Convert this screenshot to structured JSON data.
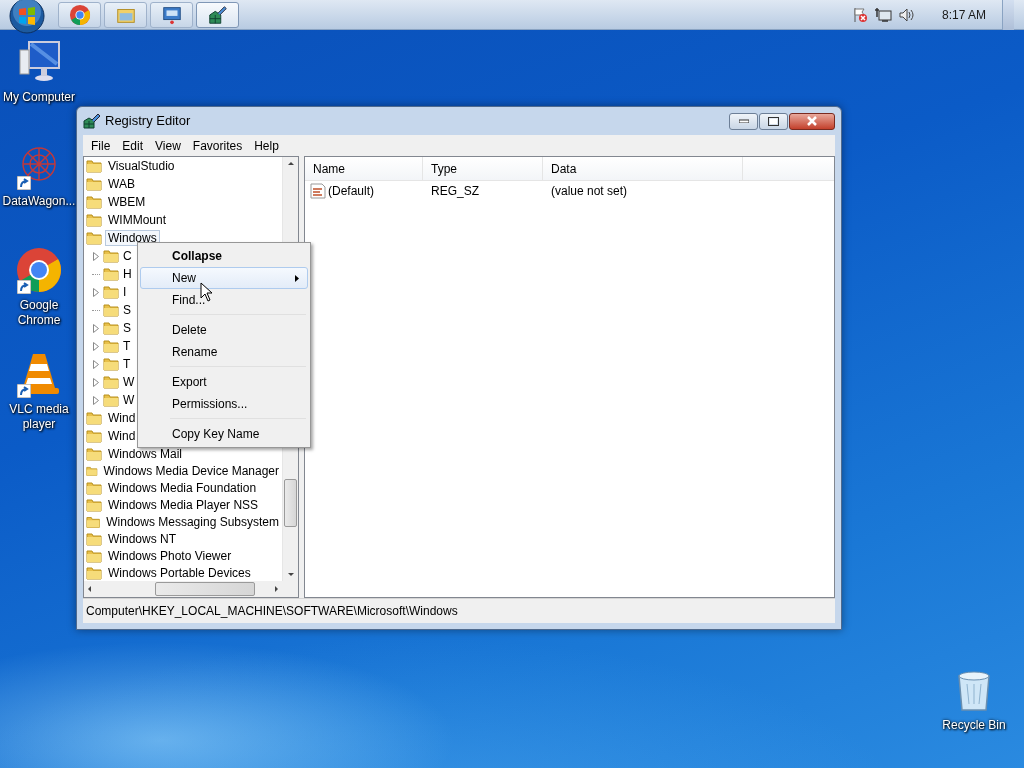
{
  "taskbar": {
    "buttons": [
      {
        "kind": "chrome",
        "selected": false
      },
      {
        "kind": "explorer",
        "selected": false
      },
      {
        "kind": "remote",
        "selected": false
      },
      {
        "kind": "regedit",
        "selected": true
      }
    ],
    "clock": "8:17 AM"
  },
  "desktop_icons": [
    {
      "kind": "computer",
      "label": "My Computer",
      "shortcut": false
    },
    {
      "kind": "datawagon",
      "label": "DataWagon...",
      "shortcut": true
    },
    {
      "kind": "chrome",
      "label": "Google Chrome",
      "shortcut": true
    },
    {
      "kind": "vlc",
      "label": "VLC media player",
      "shortcut": true
    },
    {
      "kind": "recycle",
      "label": "Recycle Bin",
      "shortcut": false
    }
  ],
  "window": {
    "title": "Registry Editor",
    "menu": [
      "File",
      "Edit",
      "View",
      "Favorites",
      "Help"
    ],
    "tree": [
      {
        "label": "VisualStudio",
        "selected": false
      },
      {
        "label": "WAB",
        "selected": false
      },
      {
        "label": "WBEM",
        "selected": false
      },
      {
        "label": "WIMMount",
        "selected": false
      },
      {
        "label": "Windows",
        "selected": true,
        "children": [
          {
            "label": "C",
            "expandable": true
          },
          {
            "label": "H",
            "expandable": false
          },
          {
            "label": "I",
            "expandable": true
          },
          {
            "label": "S",
            "expandable": false
          },
          {
            "label": "S",
            "expandable": true
          },
          {
            "label": "T",
            "expandable": true
          },
          {
            "label": "T",
            "expandable": true
          },
          {
            "label": "W",
            "expandable": true
          },
          {
            "label": "W",
            "expandable": true
          }
        ]
      },
      {
        "label": "Wind",
        "selected": false
      },
      {
        "label": "Wind",
        "selected": false
      },
      {
        "label": "Windows Mail",
        "selected": false
      },
      {
        "label": "Windows Media Device Manager",
        "selected": false
      },
      {
        "label": "Windows Media Foundation",
        "selected": false
      },
      {
        "label": "Windows Media Player NSS",
        "selected": false
      },
      {
        "label": "Windows Messaging Subsystem",
        "selected": false
      },
      {
        "label": "Windows NT",
        "selected": false
      },
      {
        "label": "Windows Photo Viewer",
        "selected": false
      },
      {
        "label": "Windows Portable Devices",
        "selected": false
      }
    ],
    "values": {
      "columns": [
        "Name",
        "Type",
        "Data"
      ],
      "rows": [
        {
          "name": "(Default)",
          "type": "REG_SZ",
          "data": "(value not set)"
        }
      ]
    },
    "status_bar": "Computer\\HKEY_LOCAL_MACHINE\\SOFTWARE\\Microsoft\\Windows"
  },
  "context_menu": {
    "items": [
      {
        "kind": "item",
        "label": "Collapse",
        "bold": true,
        "submenu": false,
        "selected": false
      },
      {
        "kind": "item",
        "label": "New",
        "bold": false,
        "submenu": true,
        "selected": true
      },
      {
        "kind": "item",
        "label": "Find...",
        "bold": false,
        "submenu": false,
        "selected": false
      },
      {
        "kind": "separator"
      },
      {
        "kind": "item",
        "label": "Delete",
        "bold": false,
        "submenu": false,
        "selected": false
      },
      {
        "kind": "item",
        "label": "Rename",
        "bold": false,
        "submenu": false,
        "selected": false
      },
      {
        "kind": "separator"
      },
      {
        "kind": "item",
        "label": "Export",
        "bold": false,
        "submenu": false,
        "selected": false
      },
      {
        "kind": "item",
        "label": "Permissions...",
        "bold": false,
        "submenu": false,
        "selected": false
      },
      {
        "kind": "separator"
      },
      {
        "kind": "item",
        "label": "Copy Key Name",
        "bold": false,
        "submenu": false,
        "selected": false
      }
    ]
  }
}
